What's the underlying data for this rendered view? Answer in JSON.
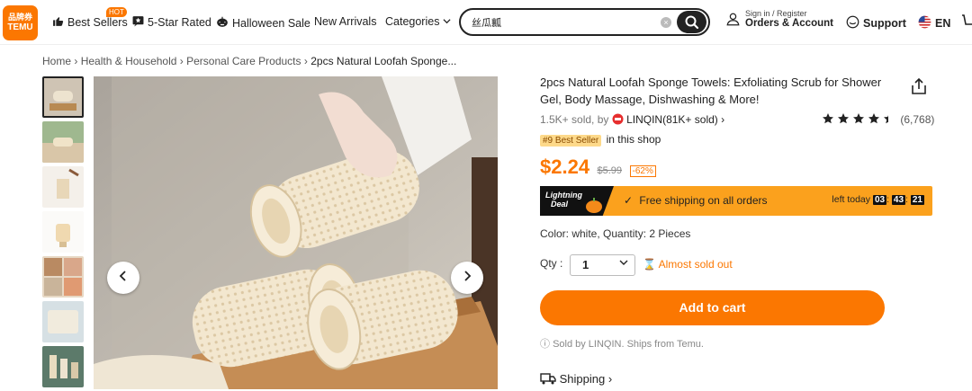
{
  "header": {
    "logo_top": "品牌券",
    "logo_bottom": "TEMU",
    "nav": {
      "best_sellers": "Best Sellers",
      "hot": "HOT",
      "five_star": "5-Star Rated",
      "halloween": "Halloween Sale",
      "new_arrivals": "New Arrivals",
      "categories": "Categories"
    },
    "search_value": "丝瓜瓤",
    "account_small": "Sign in / Register",
    "account_big": "Orders & Account",
    "support": "Support",
    "language": "EN"
  },
  "breadcrumb": {
    "home": "Home",
    "c1": "Health & Household",
    "c2": "Personal Care Products",
    "c3": "2pcs Natural Loofah Sponge..."
  },
  "product": {
    "title": "2pcs Natural Loofah Sponge Towels: Exfoliating Scrub for Shower Gel, Body Massage, Dishwashing & More!",
    "sold": "1.5K+ sold, by",
    "store": "LINQIN(81K+ sold)",
    "rating_value": 4.5,
    "rating_count": "(6,768)",
    "badge": "#9 Best Seller",
    "badge_suffix": "in this shop",
    "price": "$2.24",
    "old_price": "$5.99",
    "discount": "-62%",
    "deal_label_1": "Lightning",
    "deal_label_2": "Deal",
    "free_shipping": "Free shipping on all orders",
    "left_today": "left today",
    "timer_h": "03",
    "timer_m": "43",
    "timer_s": "21",
    "color_qty": "Color: white, Quantity: 2 Pieces",
    "qty_label": "Qty :",
    "qty_value": "1",
    "almost_sold_out": "Almost sold out",
    "add_to_cart": "Add to cart",
    "sold_by": "Sold by LINQIN. Ships from Temu.",
    "shipping": "Shipping"
  },
  "colors": {
    "brand": "#fb7701",
    "deal_bar": "#fba11d"
  }
}
